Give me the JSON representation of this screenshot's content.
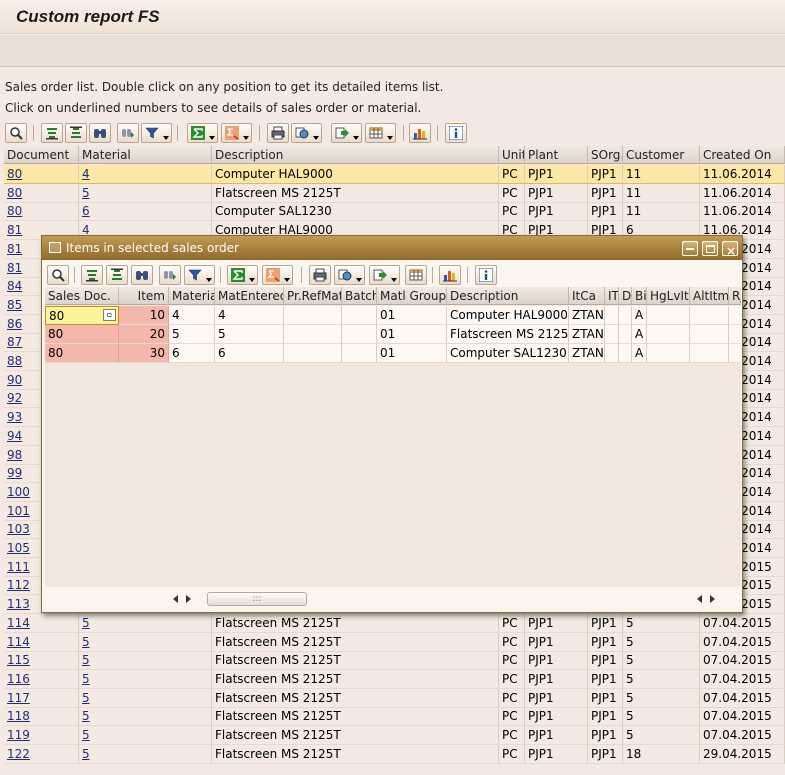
{
  "window": {
    "title": "Custom report FS"
  },
  "info_lines": [
    "Sales order list. Double click on any position to get its detailed items list.",
    "Click on underlined numbers to see details of sales order or material."
  ],
  "main_toolbar": [
    {
      "name": "details-button",
      "icon": "magnifier-icon",
      "dropdown": false
    },
    {
      "name": "sort-ascending-button",
      "icon": "sort-ascending-icon",
      "dropdown": false
    },
    {
      "name": "sort-descending-button",
      "icon": "sort-descending-icon",
      "dropdown": false
    },
    {
      "name": "find-button",
      "icon": "binoculars-icon",
      "dropdown": false
    },
    {
      "name": "find-next-button",
      "icon": "find-next-icon",
      "dropdown": false
    },
    {
      "name": "filter-button",
      "icon": "filter-icon",
      "dropdown": true
    },
    {
      "name": "sum-button",
      "icon": "sigma-icon",
      "dropdown": true
    },
    {
      "name": "subtotals-button",
      "icon": "subtotals-icon",
      "dropdown": true
    },
    {
      "name": "print-button",
      "icon": "printer-icon",
      "dropdown": false
    },
    {
      "name": "views-button",
      "icon": "views-icon",
      "dropdown": true
    },
    {
      "name": "export-button",
      "icon": "export-icon",
      "dropdown": true
    },
    {
      "name": "layout-button",
      "icon": "layout-icon",
      "dropdown": true
    },
    {
      "name": "graphic-button",
      "icon": "chart-icon",
      "dropdown": false
    },
    {
      "name": "info-button",
      "icon": "info-icon",
      "dropdown": false
    }
  ],
  "main_grid": {
    "columns": [
      "Document",
      "Material",
      "Description",
      "Unit",
      "Plant",
      "SOrg.",
      "Customer",
      "Created On"
    ],
    "rows": [
      [
        "80",
        "4",
        "Computer HAL9000",
        "PC",
        "PJP1",
        "PJP1",
        "11",
        "11.06.2014"
      ],
      [
        "80",
        "5",
        "Flatscreen MS 2125T",
        "PC",
        "PJP1",
        "PJP1",
        "11",
        "11.06.2014"
      ],
      [
        "80",
        "6",
        "Computer SAL1230",
        "PC",
        "PJP1",
        "PJP1",
        "11",
        "11.06.2014"
      ],
      [
        "81",
        "4",
        "Computer HAL9000",
        "PC",
        "PJP1",
        "PJP1",
        "6",
        "11.06.2014"
      ],
      [
        "81",
        "",
        "",
        "",
        "",
        "",
        "",
        "11.06.2014"
      ],
      [
        "81",
        "",
        "",
        "",
        "",
        "",
        "",
        "11.06.2014"
      ],
      [
        "84",
        "",
        "",
        "",
        "",
        "",
        "",
        "11.06.2014"
      ],
      [
        "85",
        "",
        "",
        "",
        "",
        "",
        "",
        "11.06.2014"
      ],
      [
        "86",
        "",
        "",
        "",
        "",
        "",
        "",
        "11.06.2014"
      ],
      [
        "87",
        "",
        "",
        "",
        "",
        "",
        "",
        "11.06.2014"
      ],
      [
        "88",
        "",
        "",
        "",
        "",
        "",
        "",
        "11.06.2014"
      ],
      [
        "90",
        "",
        "",
        "",
        "",
        "",
        "",
        "11.06.2014"
      ],
      [
        "92",
        "",
        "",
        "",
        "",
        "",
        "",
        "11.06.2014"
      ],
      [
        "93",
        "",
        "",
        "",
        "",
        "",
        "",
        "11.06.2014"
      ],
      [
        "94",
        "",
        "",
        "",
        "",
        "",
        "",
        "11.06.2014"
      ],
      [
        "98",
        "",
        "",
        "",
        "",
        "",
        "",
        "11.06.2014"
      ],
      [
        "99",
        "",
        "",
        "",
        "",
        "",
        "",
        "11.06.2014"
      ],
      [
        "100",
        "",
        "",
        "",
        "",
        "",
        "",
        "11.06.2014"
      ],
      [
        "101",
        "",
        "",
        "",
        "",
        "",
        "",
        "11.06.2014"
      ],
      [
        "103",
        "",
        "",
        "",
        "",
        "",
        "",
        "11.06.2014"
      ],
      [
        "105",
        "",
        "",
        "",
        "",
        "",
        "",
        "11.06.2014"
      ],
      [
        "111",
        "",
        "",
        "",
        "",
        "",
        "",
        "07.04.2015"
      ],
      [
        "112",
        "",
        "",
        "",
        "",
        "",
        "",
        "07.04.2015"
      ],
      [
        "113",
        "",
        "",
        "",
        "",
        "",
        "",
        "07.04.2015"
      ],
      [
        "114",
        "5",
        "Flatscreen MS 2125T",
        "PC",
        "PJP1",
        "PJP1",
        "5",
        "07.04.2015"
      ],
      [
        "114",
        "5",
        "Flatscreen MS 2125T",
        "PC",
        "PJP1",
        "PJP1",
        "5",
        "07.04.2015"
      ],
      [
        "115",
        "5",
        "Flatscreen MS 2125T",
        "PC",
        "PJP1",
        "PJP1",
        "5",
        "07.04.2015"
      ],
      [
        "116",
        "5",
        "Flatscreen MS 2125T",
        "PC",
        "PJP1",
        "PJP1",
        "5",
        "07.04.2015"
      ],
      [
        "117",
        "5",
        "Flatscreen MS 2125T",
        "PC",
        "PJP1",
        "PJP1",
        "5",
        "07.04.2015"
      ],
      [
        "118",
        "5",
        "Flatscreen MS 2125T",
        "PC",
        "PJP1",
        "PJP1",
        "5",
        "07.04.2015"
      ],
      [
        "119",
        "5",
        "Flatscreen MS 2125T",
        "PC",
        "PJP1",
        "PJP1",
        "5",
        "07.04.2015"
      ],
      [
        "122",
        "5",
        "Flatscreen MS 2125T",
        "PC",
        "PJP1",
        "PJP1",
        "18",
        "29.04.2015"
      ]
    ]
  },
  "dialog": {
    "title": "Items in selected sales order",
    "toolbar": [
      {
        "name": "details-button",
        "icon": "magnifier-icon",
        "dropdown": false
      },
      {
        "name": "sort-ascending-button",
        "icon": "sort-ascending-icon",
        "dropdown": false
      },
      {
        "name": "sort-descending-button",
        "icon": "sort-descending-icon",
        "dropdown": false
      },
      {
        "name": "find-button",
        "icon": "binoculars-icon",
        "dropdown": false
      },
      {
        "name": "find-next-button",
        "icon": "find-next-icon",
        "dropdown": false
      },
      {
        "name": "filter-button",
        "icon": "filter-icon",
        "dropdown": true
      },
      {
        "name": "sum-button",
        "icon": "sigma-icon",
        "dropdown": true
      },
      {
        "name": "subtotals-button",
        "icon": "subtotals-icon",
        "dropdown": true
      },
      {
        "name": "print-button",
        "icon": "printer-icon",
        "dropdown": false
      },
      {
        "name": "views-button",
        "icon": "views-icon",
        "dropdown": true
      },
      {
        "name": "export-button",
        "icon": "export-icon",
        "dropdown": true
      },
      {
        "name": "layout-button",
        "icon": "layout-icon",
        "dropdown": false
      },
      {
        "name": "graphic-button",
        "icon": "chart-icon",
        "dropdown": false
      },
      {
        "name": "info-button",
        "icon": "info-icon",
        "dropdown": false
      }
    ],
    "columns": [
      "Sales Doc.",
      "Item",
      "Material",
      "MatEntered",
      "Pr.RefMatl",
      "Batch",
      "Matl Group",
      "Description",
      "ItCa",
      "IT",
      "Dl",
      "Bi",
      "HgLvIt",
      "AltItm",
      "Rj"
    ],
    "rows": [
      [
        "80",
        "10",
        "4",
        "4",
        "",
        "",
        "01",
        "Computer HAL9000",
        "ZTAN",
        "",
        "",
        "A",
        "",
        "",
        ""
      ],
      [
        "80",
        "20",
        "5",
        "5",
        "",
        "",
        "01",
        "Flatscreen MS 2125T",
        "ZTAN",
        "",
        "",
        "A",
        "",
        "",
        ""
      ],
      [
        "80",
        "30",
        "6",
        "6",
        "",
        "",
        "01",
        "Computer SAL1230",
        "ZTAN",
        "",
        "",
        "A",
        "",
        "",
        ""
      ]
    ]
  },
  "colors": {
    "selected_row": "#fbe8a7",
    "key_cell": "#f4b7ac",
    "dialog_title": "#a07c3c"
  }
}
